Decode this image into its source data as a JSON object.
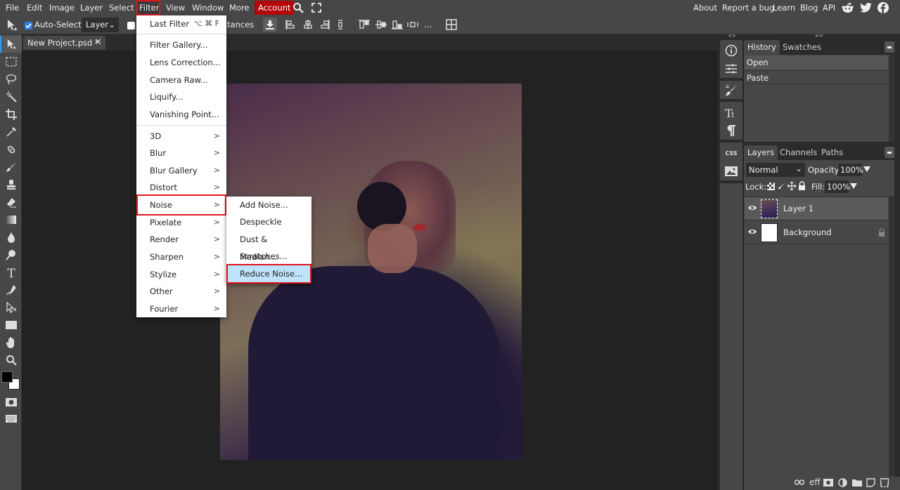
{
  "menubar": {
    "items": [
      "File",
      "Edit",
      "Image",
      "Layer",
      "Select",
      "Filter",
      "View",
      "Window",
      "More"
    ],
    "active_item": "Filter",
    "account_label": "Account",
    "right_links": [
      "About",
      "Report a bug",
      "Learn",
      "Blog",
      "API"
    ],
    "social_icons": [
      "reddit-icon",
      "twitter-icon",
      "facebook-icon"
    ]
  },
  "options_bar": {
    "auto_select_label": "Auto-Select",
    "auto_select_checked": true,
    "auto_select_target": "Layer",
    "distances_label": "Distances",
    "more_label": "..."
  },
  "document": {
    "tab_title": "New Project.psd *"
  },
  "filter_menu": {
    "last_filter": {
      "label": "Last Filter",
      "shortcut": "⌥ ⌘ F"
    },
    "items": [
      "Filter Gallery...",
      "Lens Correction...",
      "Camera Raw...",
      "Liquify...",
      "Vanishing Point..."
    ],
    "submenus": [
      "3D",
      "Blur",
      "Blur Gallery",
      "Distort",
      "Noise",
      "Pixelate",
      "Render",
      "Sharpen",
      "Stylize",
      "Other",
      "Fourier"
    ],
    "highlighted": "Noise"
  },
  "noise_submenu": {
    "items": [
      "Add Noise...",
      "Despeckle",
      "Dust & Scratches...",
      "Median...",
      "Reduce Noise..."
    ],
    "highlighted": "Reduce Noise..."
  },
  "history_panel": {
    "tabs": [
      "History",
      "Swatches"
    ],
    "active_tab": "History",
    "entries": [
      "Open",
      "Paste"
    ]
  },
  "layers_panel": {
    "tabs": [
      "Layers",
      "Channels",
      "Paths"
    ],
    "active_tab": "Layers",
    "blend_mode": "Normal",
    "opacity_label": "Opacity:",
    "opacity": "100%",
    "lock_label": "Lock:",
    "fill_label": "Fill:",
    "fill": "100%",
    "layers": [
      {
        "name": "Layer 1",
        "visible": true,
        "selected": true,
        "locked": false
      },
      {
        "name": "Background",
        "visible": true,
        "selected": false,
        "locked": true
      }
    ],
    "footer_effects_label": "eff"
  },
  "side_icons": {
    "css_label": "CSS"
  },
  "colors": {
    "accent_red": "#e0141e",
    "account_red": "#b4040c",
    "highlight_blue": "#bfe3fb",
    "panel_bg": "#474747",
    "dark_bg": "#222222"
  }
}
